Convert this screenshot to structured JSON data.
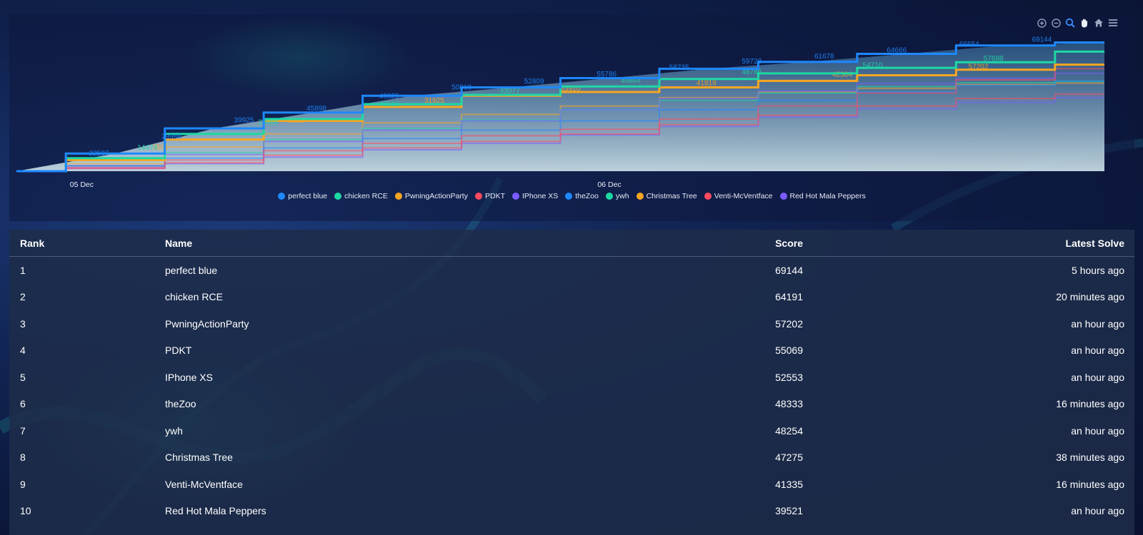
{
  "colors": {
    "perfect_blue": "#1e88ff",
    "chicken_rce": "#1ed8a4",
    "pwning": "#f5a623",
    "pdkt": "#ff4a60",
    "iphone": "#7a5cff",
    "thezoo": "#1e88ff",
    "ywh": "#1ed8a4",
    "christmas": "#f5a623",
    "venti": "#ff4a60",
    "redhot": "#7a5cff"
  },
  "toolbar": {
    "zoom_in_icon": "zoom-in-icon",
    "zoom_out_icon": "zoom-out-icon",
    "selection_zoom_icon": "magnifier-icon",
    "pan_icon": "hand-icon",
    "reset_icon": "home-icon",
    "menu_icon": "menu-icon"
  },
  "chart_data": {
    "type": "line",
    "x_ticks": [
      "05 Dec",
      "06 Dec"
    ],
    "series": [
      {
        "name": "perfect blue",
        "color": "#1e88ff",
        "values": [
          0,
          9500,
          23000,
          31500,
          40500,
          45000,
          50000,
          55000,
          58700,
          63000,
          67500,
          69144
        ],
        "labels": [
          "22507",
          "29988",
          "39925",
          "45898",
          "49825",
          "50818",
          "52809",
          "55786",
          "58735",
          "59728",
          "61678",
          "64666",
          "66654",
          "69144"
        ]
      },
      {
        "name": "chicken RCE",
        "color": "#1ed8a4",
        "values": [
          0,
          7000,
          20000,
          28000,
          36000,
          41000,
          45500,
          49500,
          52500,
          55500,
          58500,
          64191
        ],
        "labels": [
          "14474",
          "29988",
          "40516",
          "43077",
          "46864",
          "48786",
          "54710",
          "57698"
        ]
      },
      {
        "name": "PwningActionParty",
        "color": "#f5a623",
        "values": [
          0,
          6000,
          17000,
          27000,
          34500,
          40500,
          42500,
          45000,
          48500,
          51500,
          54500,
          57202
        ],
        "labels": [
          "2501",
          "5853",
          "31925",
          "33910",
          "41819",
          "42304",
          "57202"
        ]
      },
      {
        "name": "PDKT",
        "color": "#ff4a60",
        "values": [
          0,
          2000,
          6000,
          11000,
          15000,
          19000,
          22500,
          28000,
          35000,
          42000,
          49000,
          55069
        ],
        "labels": []
      },
      {
        "name": "IPhone XS",
        "color": "#7a5cff",
        "values": [
          0,
          3000,
          9000,
          16000,
          22000,
          27000,
          33000,
          39000,
          43000,
          47000,
          50000,
          52553
        ],
        "labels": []
      },
      {
        "name": "theZoo",
        "color": "#1e88ff",
        "values": [
          0,
          2500,
          7000,
          12500,
          17500,
          22000,
          27000,
          33000,
          38000,
          42500,
          46000,
          48333
        ],
        "labels": []
      },
      {
        "name": "ywh",
        "color": "#1ed8a4",
        "values": [
          0,
          3000,
          10000,
          17000,
          23000,
          27500,
          33000,
          38000,
          42000,
          45500,
          47500,
          48254
        ],
        "labels": []
      },
      {
        "name": "Christmas Tree",
        "color": "#f5a623",
        "values": [
          0,
          4000,
          13000,
          20000,
          26000,
          30500,
          35000,
          39500,
          42500,
          44500,
          46500,
          47275
        ],
        "labels": []
      },
      {
        "name": "Venti-McVentface",
        "color": "#ff4a60",
        "values": [
          0,
          1500,
          4500,
          8500,
          12500,
          16000,
          20000,
          25000,
          30000,
          35000,
          39000,
          41335
        ],
        "labels": []
      },
      {
        "name": "Red Hot Mala Peppers",
        "color": "#7a5cff",
        "values": [
          0,
          1500,
          4000,
          7500,
          11500,
          15000,
          19500,
          24000,
          29000,
          33500,
          37000,
          39521
        ],
        "labels": []
      }
    ],
    "ylim": [
      0,
      72000
    ]
  },
  "table": {
    "headers": {
      "rank": "Rank",
      "name": "Name",
      "score": "Score",
      "latest": "Latest Solve"
    },
    "rows": [
      {
        "rank": "1",
        "name": "perfect blue",
        "score": "69144",
        "latest": "5 hours ago"
      },
      {
        "rank": "2",
        "name": "chicken RCE",
        "score": "64191",
        "latest": "20 minutes ago"
      },
      {
        "rank": "3",
        "name": "PwningActionParty",
        "score": "57202",
        "latest": "an hour ago"
      },
      {
        "rank": "4",
        "name": "PDKT",
        "score": "55069",
        "latest": "an hour ago"
      },
      {
        "rank": "5",
        "name": "IPhone XS",
        "score": "52553",
        "latest": "an hour ago"
      },
      {
        "rank": "6",
        "name": "theZoo",
        "score": "48333",
        "latest": "16 minutes ago"
      },
      {
        "rank": "7",
        "name": "ywh",
        "score": "48254",
        "latest": "an hour ago"
      },
      {
        "rank": "8",
        "name": "Christmas Tree",
        "score": "47275",
        "latest": "38 minutes ago"
      },
      {
        "rank": "9",
        "name": "Venti-McVentface",
        "score": "41335",
        "latest": "16 minutes ago"
      },
      {
        "rank": "10",
        "name": "Red Hot Mala Peppers",
        "score": "39521",
        "latest": "an hour ago"
      }
    ]
  }
}
